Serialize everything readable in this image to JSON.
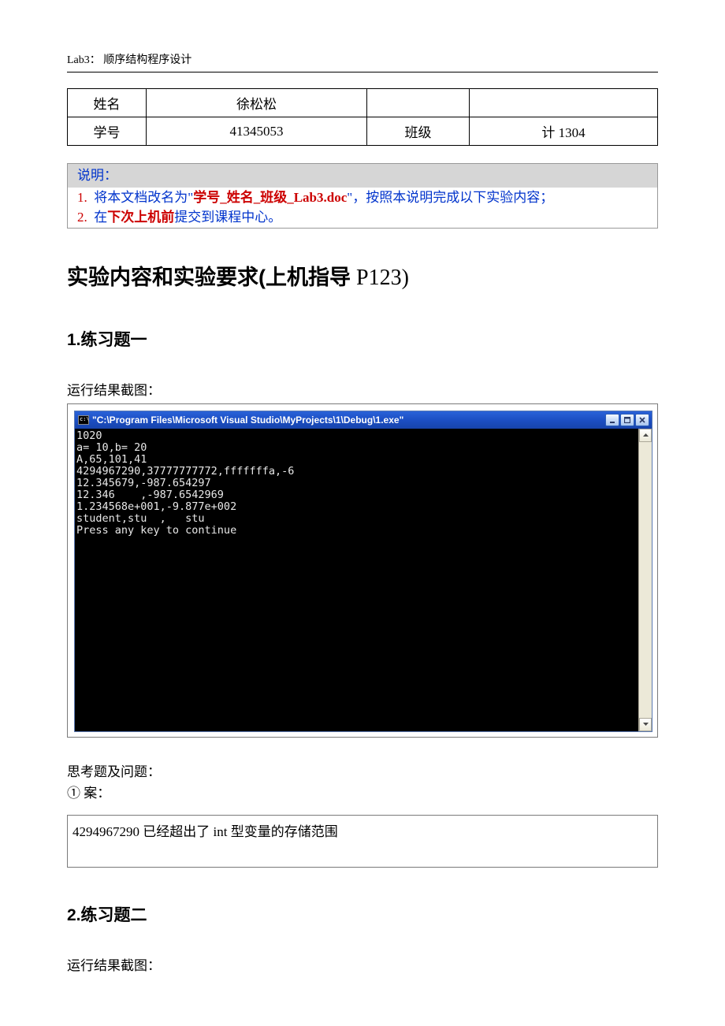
{
  "header": {
    "label": "Lab3：  顺序结构程序设计"
  },
  "info": {
    "row1_label": "姓名",
    "row1_value": "徐松松",
    "row1_label2": "",
    "row1_value2": "",
    "row2_label": "学号",
    "row2_value": "41345053",
    "row2_label2": "班级",
    "row2_value2": "计 1304"
  },
  "instructions": {
    "title": "说明：",
    "item1_num": "1.",
    "item1_prefix": "将本文档改名为\"",
    "item1_highlight": "学号_姓名_班级_Lab3.doc",
    "item1_suffix": "\"，按照本说明完成以下实验内容；",
    "item2_num": "2.",
    "item2_prefix": "在",
    "item2_highlight": "下次上机前",
    "item2_suffix": "提交到课程中心。"
  },
  "main_title": {
    "cn": "实验内容和实验要求(上机指导",
    "en": " P123)"
  },
  "section1": {
    "title": "1.练习题一",
    "caption": "运行结果截图：",
    "console_title": "\"C:\\Program Files\\Microsoft Visual Studio\\MyProjects\\1\\Debug\\1.exe\"",
    "console_lines": "1020\na= 10,b= 20\nA,65,101,41\n4294967290,37777777772,fffffffa,-6\n12.345679,-987.654297\n12.346    ,-987.6542969\n1.234568e+001,-9.877e+002\nstudent,stu  ,   stu\nPress any key to continue",
    "think_label": "思考题及问题：",
    "think_item": "①  案：",
    "answer": "4294967290 已经超出了 int 型变量的存储范围"
  },
  "section2": {
    "title": "2.练习题二",
    "caption": "运行结果截图："
  }
}
